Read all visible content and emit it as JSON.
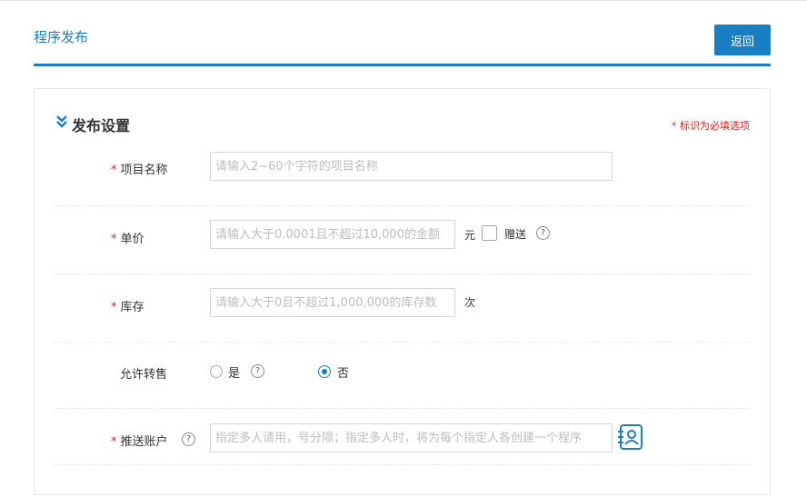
{
  "header": {
    "title": "程序发布",
    "back_label": "返回"
  },
  "section": {
    "title": "发布设置",
    "required_note": "* 标识为必填选项"
  },
  "form": {
    "required_mark": "*",
    "project_name": {
      "label": "项目名称",
      "placeholder": "请输入2~60个字符的项目名称",
      "value": ""
    },
    "price": {
      "label": "单价",
      "placeholder": "请输入大于0.0001且不超过10,000的金额",
      "value": "",
      "unit": "元",
      "gift_label": "赠送",
      "gift_checked": false
    },
    "stock": {
      "label": "库存",
      "placeholder": "请输入大于0且不超过1,000,000的库存数",
      "value": "",
      "unit": "次"
    },
    "resale": {
      "label": "允许转售",
      "options": [
        "是",
        "否"
      ],
      "selected": "否"
    },
    "push_account": {
      "label": "推送账户",
      "placeholder": "指定多人请用，号分隔；指定多人时，将为每个指定人各创建一个程序",
      "value": ""
    }
  },
  "icons": {
    "section": "double-chevron-down-icon",
    "help": "question-circle-icon",
    "contact": "contact-book-icon"
  },
  "colors": {
    "accent": "#1a7fc1",
    "required": "#e02020"
  }
}
